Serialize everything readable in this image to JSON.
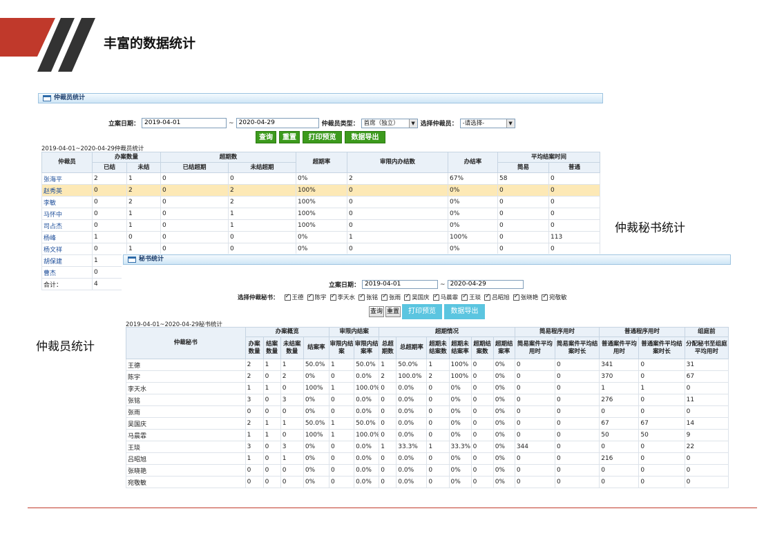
{
  "slide": {
    "title": "丰富的数据统计",
    "caption_secretary": "仲裁秘书统计",
    "caption_arbitrator": "仲裁员统计",
    "accent_color": "#c0392b",
    "slash_color": "#333333"
  },
  "panel1": {
    "title": "仲裁员统计",
    "date_label": "立案日期：",
    "date_from": "2019-04-01",
    "date_sep": "~",
    "date_to": "2020-04-29",
    "type_label": "仲裁员类型：",
    "type_value": "首席（独立）",
    "arb_label": "选择仲裁员：",
    "arb_value": "-请选择-",
    "buttons": {
      "query": "查询",
      "reset": "重置",
      "print": "打印预览",
      "export": "数据导出"
    },
    "range": "2019-04-01~2020-04-29仲裁员统计",
    "headers": {
      "name": "仲裁员",
      "case_count": "办案数量",
      "closed": "已结",
      "open": "未结",
      "overdue": "超期数",
      "closed_overdue": "已结超期",
      "open_overdue": "未结超期",
      "overdue_rate": "超期率",
      "in_limit": "审限内办结数",
      "close_rate": "办结率",
      "avg_time": "平均结案时间",
      "simple": "简易",
      "normal": "普通"
    },
    "rows": [
      [
        "张海平",
        "2",
        "1",
        "0",
        "0",
        "0%",
        "2",
        "67%",
        "58",
        "0"
      ],
      [
        "赵秀英",
        "0",
        "2",
        "0",
        "2",
        "100%",
        "0",
        "0%",
        "0",
        "0"
      ],
      [
        "李敏",
        "0",
        "2",
        "0",
        "2",
        "100%",
        "0",
        "0%",
        "0",
        "0"
      ],
      [
        "马怀中",
        "0",
        "1",
        "0",
        "1",
        "100%",
        "0",
        "0%",
        "0",
        "0"
      ],
      [
        "司占杰",
        "0",
        "1",
        "0",
        "1",
        "100%",
        "0",
        "0%",
        "0",
        "0"
      ],
      [
        "杨峰",
        "1",
        "0",
        "0",
        "0",
        "0%",
        "1",
        "100%",
        "0",
        "113"
      ],
      [
        "杨文祥",
        "0",
        "1",
        "0",
        "0",
        "0%",
        "0",
        "0%",
        "0",
        "0"
      ],
      [
        "胡保建",
        "1"
      ],
      [
        "曹杰",
        "0"
      ],
      [
        "合计：",
        "4"
      ]
    ]
  },
  "panel2": {
    "title": "秘书统计",
    "date_label": "立案日期：",
    "date_from": "2019-04-01",
    "date_sep": "~",
    "date_to": "2020-04-29",
    "sec_label": "选择仲裁秘书：",
    "secretaries": [
      "王德",
      "陈宇",
      "李天水",
      "张铭",
      "张雨",
      "吴国庆",
      "马晨霏",
      "王琰",
      "吕昭旭",
      "张晓艳",
      "宛敬敏"
    ],
    "buttons": {
      "query": "查询",
      "reset": "重置",
      "print": "打印预览",
      "export": "数据导出"
    },
    "range": "2019-04-01~2020-04-29秘书统计",
    "headers": {
      "name": "仲裁秘书",
      "overview": "办案概览",
      "in_limit": "审限内结案",
      "overdue": "超期情况",
      "simple": "简易程序用时",
      "normal": "普通程序用时",
      "tribunal": "组庭前",
      "cols": [
        "办案数量",
        "结案数量",
        "未结案数量",
        "结案率",
        "审限内结案",
        "审限内结案率",
        "总超期数",
        "总超期率",
        "超期未结案数",
        "超期未结案率",
        "超期结案数",
        "超期结案率",
        "简易案件平均用时",
        "简易案件平均结案时长",
        "普通案件平均用时",
        "普通案件平均结案时长",
        "分配秘书至组庭平均用时"
      ]
    },
    "rows": [
      [
        "王德",
        "2",
        "1",
        "1",
        "50.0%",
        "1",
        "50.0%",
        "1",
        "50.0%",
        "1",
        "100%",
        "0",
        "0%",
        "0",
        "0",
        "341",
        "0",
        "31"
      ],
      [
        "陈宇",
        "2",
        "0",
        "2",
        "0%",
        "0",
        "0.0%",
        "2",
        "100.0%",
        "2",
        "100%",
        "0",
        "0%",
        "0",
        "0",
        "370",
        "0",
        "67"
      ],
      [
        "李天水",
        "1",
        "1",
        "0",
        "100%",
        "1",
        "100.0%",
        "0",
        "0.0%",
        "0",
        "0%",
        "0",
        "0%",
        "0",
        "0",
        "1",
        "1",
        "0"
      ],
      [
        "张铭",
        "3",
        "0",
        "3",
        "0%",
        "0",
        "0.0%",
        "0",
        "0.0%",
        "0",
        "0%",
        "0",
        "0%",
        "0",
        "0",
        "276",
        "0",
        "11"
      ],
      [
        "张雨",
        "0",
        "0",
        "0",
        "0%",
        "0",
        "0.0%",
        "0",
        "0.0%",
        "0",
        "0%",
        "0",
        "0%",
        "0",
        "0",
        "0",
        "0",
        "0"
      ],
      [
        "吴国庆",
        "2",
        "1",
        "1",
        "50.0%",
        "1",
        "50.0%",
        "0",
        "0.0%",
        "0",
        "0%",
        "0",
        "0%",
        "0",
        "0",
        "67",
        "67",
        "14"
      ],
      [
        "马晨霏",
        "1",
        "1",
        "0",
        "100%",
        "1",
        "100.0%",
        "0",
        "0.0%",
        "0",
        "0%",
        "0",
        "0%",
        "0",
        "0",
        "50",
        "50",
        "9"
      ],
      [
        "王琰",
        "3",
        "0",
        "3",
        "0%",
        "0",
        "0.0%",
        "1",
        "33.3%",
        "1",
        "33.3%",
        "0",
        "0%",
        "344",
        "0",
        "0",
        "0",
        "22"
      ],
      [
        "吕昭旭",
        "1",
        "0",
        "1",
        "0%",
        "0",
        "0.0%",
        "0",
        "0.0%",
        "0",
        "0%",
        "0",
        "0%",
        "0",
        "0",
        "216",
        "0",
        "0"
      ],
      [
        "张晓艳",
        "0",
        "0",
        "0",
        "0%",
        "0",
        "0.0%",
        "0",
        "0.0%",
        "0",
        "0%",
        "0",
        "0%",
        "0",
        "0",
        "0",
        "0",
        "0"
      ],
      [
        "宛敬敏",
        "0",
        "0",
        "0",
        "0%",
        "0",
        "0.0%",
        "0",
        "0.0%",
        "0",
        "0%",
        "0",
        "0%",
        "0",
        "0",
        "0",
        "0",
        "0"
      ]
    ]
  }
}
